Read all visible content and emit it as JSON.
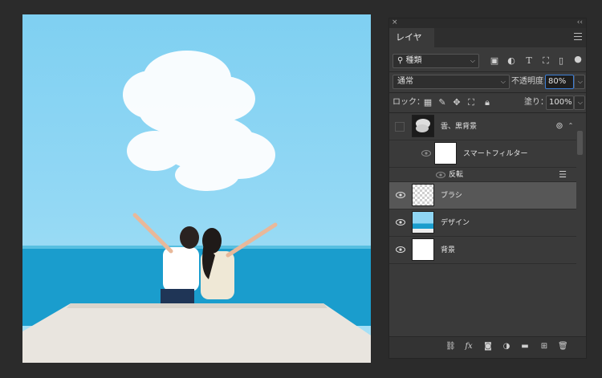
{
  "panel": {
    "close_glyph": "×",
    "collapse_glyph": "‹‹",
    "tab_label": "レイヤー",
    "filter": {
      "kind_label": "種類"
    },
    "blend": {
      "mode": "通常",
      "opacity_label": "不透明度：",
      "opacity_value": "80%"
    },
    "lock": {
      "label": "ロック：",
      "fill_label": "塗り：",
      "fill_value": "100%"
    },
    "layers": [
      {
        "name": "雲、黒背景",
        "visible": false
      },
      {
        "name": "スマートフィルター",
        "visible": true,
        "kind": "smart-filter"
      },
      {
        "name": "反転",
        "visible": true,
        "kind": "filter-item"
      },
      {
        "name": "ブラシ",
        "visible": true,
        "selected": true
      },
      {
        "name": "デザイン",
        "visible": true
      },
      {
        "name": "背景",
        "visible": true
      }
    ],
    "bottom_icons": [
      "link-icon",
      "fx-icon",
      "mask-icon",
      "adjustment-icon",
      "folder-icon",
      "new-layer-icon",
      "trash-icon"
    ],
    "fx_label": "fx"
  },
  "colors": {
    "panel_bg": "#3a3a3a",
    "selected_layer": "#575757",
    "sky": "#8fd6f4",
    "sea": "#1b9fd0"
  }
}
